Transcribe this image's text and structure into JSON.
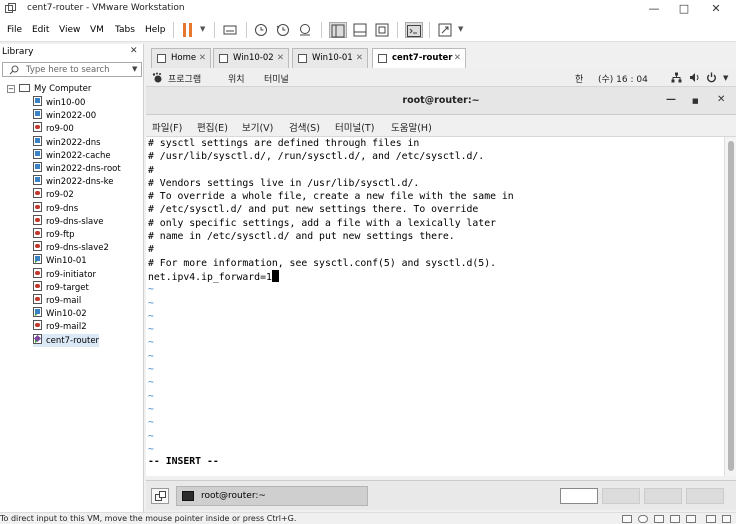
{
  "window": {
    "title": "cent7-router - VMware Workstation"
  },
  "menubar": {
    "items": [
      "File",
      "Edit",
      "View",
      "VM",
      "Tabs",
      "Help"
    ]
  },
  "library": {
    "title": "Library",
    "search_placeholder": "Type here to search",
    "root": "My Computer",
    "items": [
      {
        "label": "win10-00",
        "os": "win",
        "running": false
      },
      {
        "label": "win2022-00",
        "os": "win",
        "running": false
      },
      {
        "label": "ro9-00",
        "os": "redhat",
        "running": false
      },
      {
        "label": "win2022-dns",
        "os": "win",
        "running": false
      },
      {
        "label": "win2022-cache",
        "os": "win",
        "running": false
      },
      {
        "label": "win2022-dns-root",
        "os": "win",
        "running": false
      },
      {
        "label": "win2022-dns-ke",
        "os": "win",
        "running": false
      },
      {
        "label": "ro9-02",
        "os": "redhat",
        "running": false
      },
      {
        "label": "ro9-dns",
        "os": "redhat",
        "running": false
      },
      {
        "label": "ro9-dns-slave",
        "os": "redhat",
        "running": false
      },
      {
        "label": "ro9-ftp",
        "os": "redhat",
        "running": false
      },
      {
        "label": "ro9-dns-slave2",
        "os": "redhat",
        "running": false
      },
      {
        "label": "Win10-01",
        "os": "win",
        "running": true
      },
      {
        "label": "ro9-initiator",
        "os": "redhat",
        "running": false
      },
      {
        "label": "ro9-target",
        "os": "redhat",
        "running": false
      },
      {
        "label": "ro9-mail",
        "os": "redhat",
        "running": false
      },
      {
        "label": "Win10-02",
        "os": "win",
        "running": true
      },
      {
        "label": "ro9-mail2",
        "os": "redhat",
        "running": false
      },
      {
        "label": "cent7-router",
        "os": "centos",
        "running": true,
        "selected": true
      }
    ]
  },
  "tabs": [
    {
      "label": "Home",
      "active": false
    },
    {
      "label": "Win10-02",
      "active": false
    },
    {
      "label": "Win10-01",
      "active": false
    },
    {
      "label": "cent7-router",
      "active": true
    }
  ],
  "gnome": {
    "apps": "프로그램",
    "places": "위치",
    "terminal": "터미널",
    "input_method": "한",
    "clock": "(수) 16 : 04"
  },
  "terminal": {
    "title": "root@router:~",
    "menu": [
      "파일(F)",
      "편집(E)",
      "보기(V)",
      "검색(S)",
      "터미널(T)",
      "도움말(H)"
    ],
    "lines": [
      "# sysctl settings are defined through files in",
      "# /usr/lib/sysctl.d/, /run/sysctl.d/, and /etc/sysctl.d/.",
      "#",
      "# Vendors settings live in /usr/lib/sysctl.d/.",
      "# To override a whole file, create a new file with the same in",
      "# /etc/sysctl.d/ and put new settings there. To override",
      "# only specific settings, add a file with a lexically later",
      "# name in /etc/sysctl.d/ and put new settings there.",
      "#",
      "# For more information, see sysctl.conf(5) and sysctl.d(5).",
      "net.ipv4.ip_forward=1"
    ],
    "tilde": "~",
    "tilde_count": 13,
    "mode": "-- INSERT --"
  },
  "taskbar": {
    "task_label": "root@router:~"
  },
  "statusbar": {
    "text": "To direct input to this VM, move the mouse pointer inside or press Ctrl+G."
  },
  "colors": {
    "accent_pause": "#e8772e",
    "tilde": "#3a7fc4"
  }
}
